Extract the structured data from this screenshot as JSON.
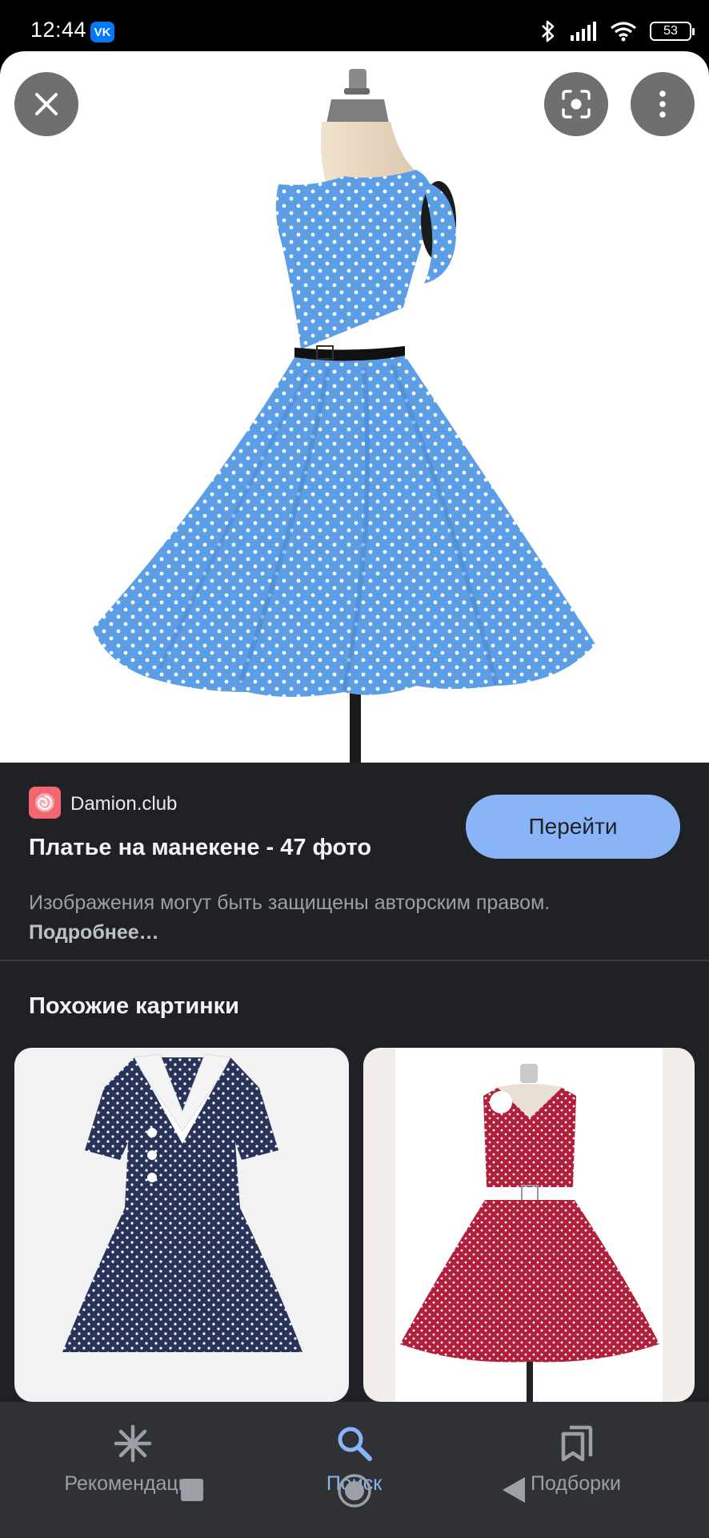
{
  "status_bar": {
    "time": "12:44",
    "app_badge": "VK",
    "battery": "53",
    "icons": [
      "bluetooth-icon",
      "signal-icon",
      "wifi-icon",
      "battery-icon"
    ]
  },
  "viewer": {
    "close_icon": "close-icon",
    "lens_icon": "lens-icon",
    "menu_icon": "more-vert-icon"
  },
  "result": {
    "site_name": "Damion.club",
    "title": "Платье на манекене - 47 фото",
    "go_button": "Перейти",
    "notice_text": "Изображения могут быть защищены авторским правом. ",
    "notice_more": "Подробнее…"
  },
  "similar": {
    "heading": "Похожие картинки"
  },
  "bottom_nav": {
    "items": [
      {
        "label": "Рекомендации",
        "icon": "sparkle-icon"
      },
      {
        "label": "Поиск",
        "icon": "search-icon",
        "active": true
      },
      {
        "label": "Подборки",
        "icon": "bookmarks-icon"
      }
    ]
  },
  "colors": {
    "accent": "#8ab4f8",
    "sheet_bg": "#202124",
    "nav_bg": "#303134"
  }
}
